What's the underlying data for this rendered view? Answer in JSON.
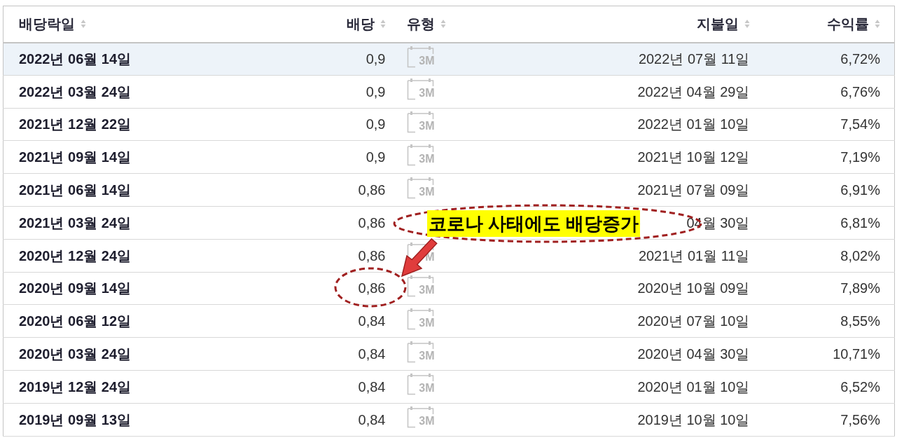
{
  "columns": [
    {
      "label": "배당락일"
    },
    {
      "label": "배당"
    },
    {
      "label": "유형"
    },
    {
      "label": "지불일"
    },
    {
      "label": "수익률"
    }
  ],
  "rows": [
    {
      "ex_date": "2022년 06월 14일",
      "dividend": "0,9",
      "type": "3M",
      "pay_date": "2022년 07월 11일",
      "yield": "6,72%",
      "selected": true
    },
    {
      "ex_date": "2022년 03월 24일",
      "dividend": "0,9",
      "type": "3M",
      "pay_date": "2022년 04월 29일",
      "yield": "6,76%",
      "selected": false
    },
    {
      "ex_date": "2021년 12월 22일",
      "dividend": "0,9",
      "type": "3M",
      "pay_date": "2022년 01월 10일",
      "yield": "7,54%",
      "selected": false
    },
    {
      "ex_date": "2021년 09월 14일",
      "dividend": "0,9",
      "type": "3M",
      "pay_date": "2021년 10월 12일",
      "yield": "7,19%",
      "selected": false
    },
    {
      "ex_date": "2021년 06월 14일",
      "dividend": "0,86",
      "type": "3M",
      "pay_date": "2021년 07월 09일",
      "yield": "6,91%",
      "selected": false
    },
    {
      "ex_date": "2021년 03월 24일",
      "dividend": "0,86",
      "pay_date": "04월 30일",
      "yield": "6,81%",
      "selected": false
    },
    {
      "ex_date": "2020년 12월 24일",
      "dividend": "0,86",
      "type": "M",
      "pay_date": "2021년 01월 11일",
      "yield": "8,02%",
      "selected": false
    },
    {
      "ex_date": "2020년 09월 14일",
      "dividend": "0,86",
      "type": "3M",
      "pay_date": "2020년 10월 09일",
      "yield": "7,89%",
      "selected": false
    },
    {
      "ex_date": "2020년 06월 12일",
      "dividend": "0,84",
      "type": "3M",
      "pay_date": "2020년 07월 10일",
      "yield": "8,55%",
      "selected": false
    },
    {
      "ex_date": "2020년 03월 24일",
      "dividend": "0,84",
      "type": "3M",
      "pay_date": "2020년 04월 30일",
      "yield": "10,71%",
      "selected": false
    },
    {
      "ex_date": "2019년 12월 24일",
      "dividend": "0,84",
      "type": "3M",
      "pay_date": "2020년 01월 10일",
      "yield": "6,52%",
      "selected": false
    },
    {
      "ex_date": "2019년 09월 13일",
      "dividend": "0,84",
      "type": "3M",
      "pay_date": "2019년 10월 10일",
      "yield": "7,56%",
      "selected": false
    }
  ],
  "annotation": {
    "label": "코로나 사태에도 배당증가"
  }
}
